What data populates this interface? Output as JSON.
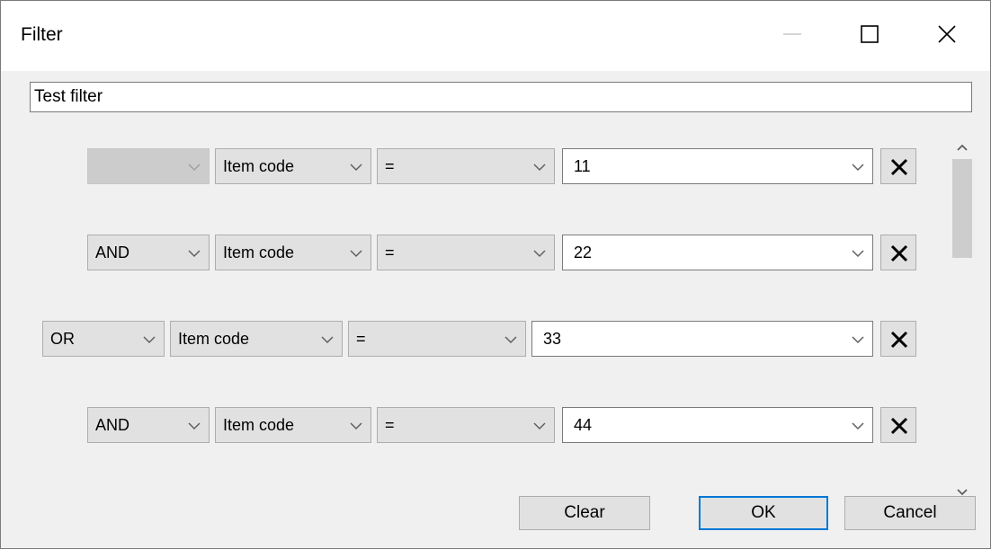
{
  "window": {
    "title": "Filter"
  },
  "filter_name": {
    "value": "Test filter"
  },
  "rows": [
    {
      "logic": "",
      "field": "Item code",
      "operator": "=",
      "value": "11"
    },
    {
      "logic": "AND",
      "field": "Item code",
      "operator": "=",
      "value": "22"
    },
    {
      "logic": "OR",
      "field": "Item code",
      "operator": "=",
      "value": "33"
    },
    {
      "logic": "AND",
      "field": "Item code",
      "operator": "=",
      "value": "44"
    }
  ],
  "buttons": {
    "clear": "Clear",
    "ok": "OK",
    "cancel": "Cancel"
  },
  "icons": {
    "minimize": "minimize-icon",
    "maximize": "maximize-icon",
    "close": "close-icon",
    "dropdown": "chevron-down-icon",
    "delete": "delete-x-icon",
    "scroll_up": "chevron-up-icon",
    "scroll_down": "chevron-down-icon"
  },
  "colors": {
    "focus_border": "#0078d7",
    "button_face": "#e1e1e1",
    "dialog_bg": "#f0f0f0"
  }
}
